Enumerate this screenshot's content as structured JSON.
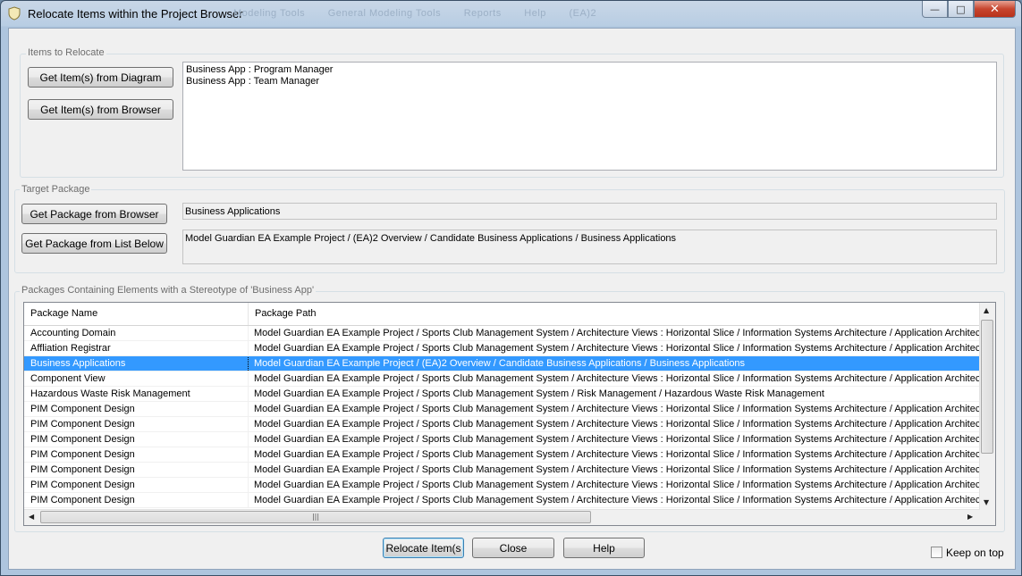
{
  "window": {
    "title": "Relocate Items within the Project Browser",
    "ghost_menu": [
      "Modeling Tools",
      "General Modeling Tools",
      "Reports",
      "Help",
      "(EA)2"
    ],
    "controls": {
      "minimize": "—",
      "maximize": "□",
      "close": "✕"
    }
  },
  "items_group": {
    "label": "Items to Relocate",
    "btn_from_diagram": "Get Item(s) from Diagram",
    "btn_from_browser": "Get Item(s) from Browser",
    "items": [
      "Business App : Program Manager",
      "Business App : Team Manager"
    ]
  },
  "target_group": {
    "label": "Target Package",
    "btn_from_browser": "Get Package from Browser",
    "btn_from_list": "Get Package from List Below",
    "package_name": "Business Applications",
    "package_path": "Model Guardian EA Example Project / (EA)2 Overview / Candidate Business Applications / Business Applications"
  },
  "packages_group": {
    "label": "Packages Containing Elements with a Stereotype of 'Business App'",
    "columns": [
      "Package Name",
      "Package Path"
    ],
    "rows": [
      {
        "name": "Accounting Domain",
        "path": "Model Guardian EA Example Project / Sports Club Management System / Architecture Views : Horizontal Slice / Information Systems Architecture / Application Architecture"
      },
      {
        "name": "Affliation Registrar",
        "path": "Model Guardian EA Example Project / Sports Club Management System / Architecture Views : Horizontal Slice / Information Systems Architecture / Application Architecture"
      },
      {
        "name": "Business Applications",
        "path": "Model Guardian EA Example Project / (EA)2 Overview / Candidate Business Applications / Business Applications",
        "selected": true
      },
      {
        "name": "Component View",
        "path": "Model Guardian EA Example Project / Sports Club Management System / Architecture Views : Horizontal Slice / Information Systems Architecture / Application Architecture"
      },
      {
        "name": "Hazardous Waste Risk Management",
        "path": "Model Guardian EA Example Project / Sports Club Management System / Risk Management / Hazardous Waste Risk Management"
      },
      {
        "name": "PIM Component Design",
        "path": "Model Guardian EA Example Project / Sports Club Management System / Architecture Views : Horizontal Slice / Information Systems Architecture / Application Architecture"
      },
      {
        "name": "PIM Component Design",
        "path": "Model Guardian EA Example Project / Sports Club Management System / Architecture Views : Horizontal Slice / Information Systems Architecture / Application Architecture"
      },
      {
        "name": "PIM Component Design",
        "path": "Model Guardian EA Example Project / Sports Club Management System / Architecture Views : Horizontal Slice / Information Systems Architecture / Application Architecture"
      },
      {
        "name": "PIM Component Design",
        "path": "Model Guardian EA Example Project / Sports Club Management System / Architecture Views : Horizontal Slice / Information Systems Architecture / Application Architecture"
      },
      {
        "name": "PIM Component Design",
        "path": "Model Guardian EA Example Project / Sports Club Management System / Architecture Views : Horizontal Slice / Information Systems Architecture / Application Architecture"
      },
      {
        "name": "PIM Component Design",
        "path": "Model Guardian EA Example Project / Sports Club Management System / Architecture Views : Horizontal Slice / Information Systems Architecture / Application Architecture"
      },
      {
        "name": "PIM Component Design",
        "path": "Model Guardian EA Example Project / Sports Club Management System / Architecture Views : Horizontal Slice / Information Systems Architecture / Application Architecture"
      }
    ]
  },
  "footer": {
    "relocate": "Relocate Item(s",
    "close": "Close",
    "help": "Help",
    "keep_on_top": "Keep on top",
    "keep_on_top_checked": false
  },
  "colors": {
    "selection": "#3399ff",
    "close_button": "#c7452e"
  }
}
